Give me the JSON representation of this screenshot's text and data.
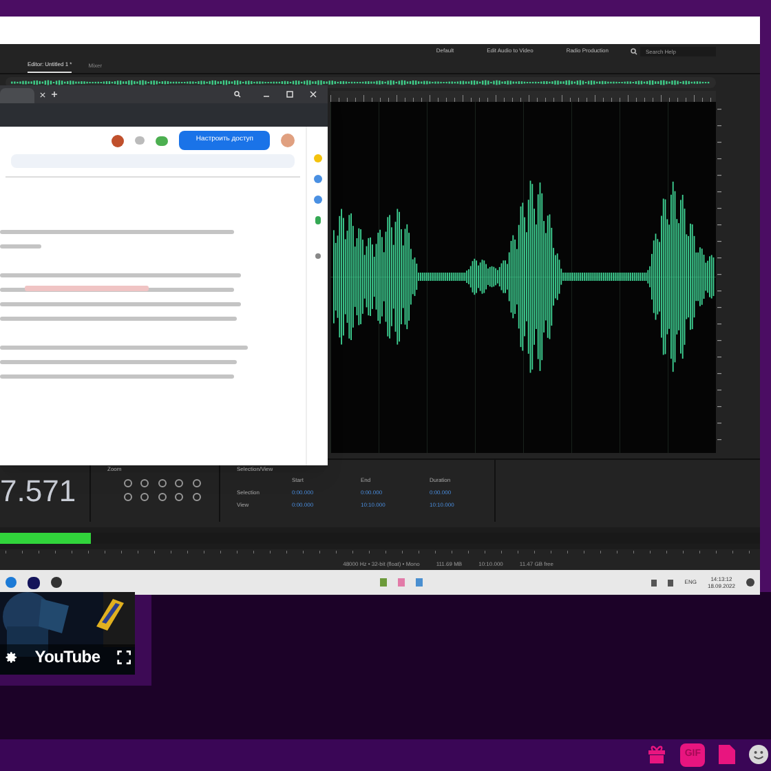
{
  "audition": {
    "workspaces": [
      "Default",
      "Edit Audio to Video",
      "Radio Production"
    ],
    "search": {
      "placeholder": "Search Help"
    },
    "tabs": [
      {
        "label": "Editor: Untitled 1 *",
        "selected": true
      },
      {
        "label": "Mixer",
        "selected": false
      }
    ],
    "time": "7.571",
    "zoom_panel": {
      "title": "Zoom"
    },
    "selection_panel": {
      "title": "Selection/View",
      "columns": [
        "Start",
        "End",
        "Duration"
      ],
      "rows": [
        {
          "label": "Selection",
          "values": [
            "0:00.000",
            "0:00.000",
            "0:00.000"
          ]
        },
        {
          "label": "View",
          "values": [
            "0:00.000",
            "10:10.000",
            "10:10.000"
          ]
        }
      ]
    },
    "meter": {
      "level": 0.12
    },
    "status_bar": [
      "48000 Hz • 32-bit (float) • Mono",
      "111.69 MB",
      "10:10.000",
      "11.47 GB free"
    ]
  },
  "browser": {
    "share_button": "Настроить доступ"
  },
  "taskbar": {
    "language": "ENG",
    "time": "14:13:12",
    "date": "18.09.2022"
  },
  "video": {
    "brand": "YouTube"
  },
  "chat_bar": {
    "gif_button": "GIF"
  }
}
